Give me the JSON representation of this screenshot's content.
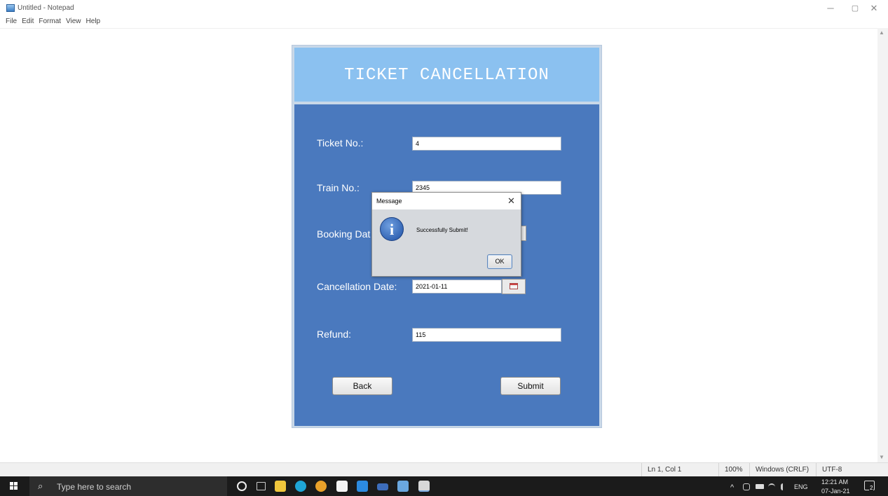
{
  "window": {
    "title": "Untitled - Notepad",
    "controls": {
      "minimize": "─",
      "maximize": "▢",
      "close": "✕"
    }
  },
  "menu": [
    "File",
    "Edit",
    "Format",
    "View",
    "Help"
  ],
  "status_bar": {
    "position": "Ln 1, Col 1",
    "zoom": "100%",
    "line_ending": "Windows (CRLF)",
    "encoding": "UTF-8"
  },
  "form": {
    "heading": "TICKET CANCELLATION",
    "fields": {
      "ticket_no": {
        "label": "Ticket No.:",
        "value": "4"
      },
      "train_no": {
        "label": "Train No.:",
        "value": "2345"
      },
      "booking_date": {
        "label": "Booking Dat"
      },
      "cancellation_date": {
        "label": "Cancellation Date:",
        "value": "2021-01-11"
      },
      "refund": {
        "label": "Refund:",
        "value": "115"
      }
    },
    "buttons": {
      "back": "Back",
      "submit": "Submit"
    }
  },
  "dialog": {
    "title": "Message",
    "close": "✕",
    "icon": "i",
    "message": "Successfully Submit!",
    "ok": "OK"
  },
  "taskbar": {
    "search_placeholder": "Type here to search",
    "search_icon": "⌕",
    "tray": {
      "chevron": "^",
      "language": "ENG",
      "time": "12:21 AM",
      "date": "07-Jan-21",
      "notifications": "2"
    }
  },
  "colors": {
    "form_body": "#4a79be",
    "form_header": "#8bc1f0",
    "taskbar": "#1b1b1b"
  }
}
